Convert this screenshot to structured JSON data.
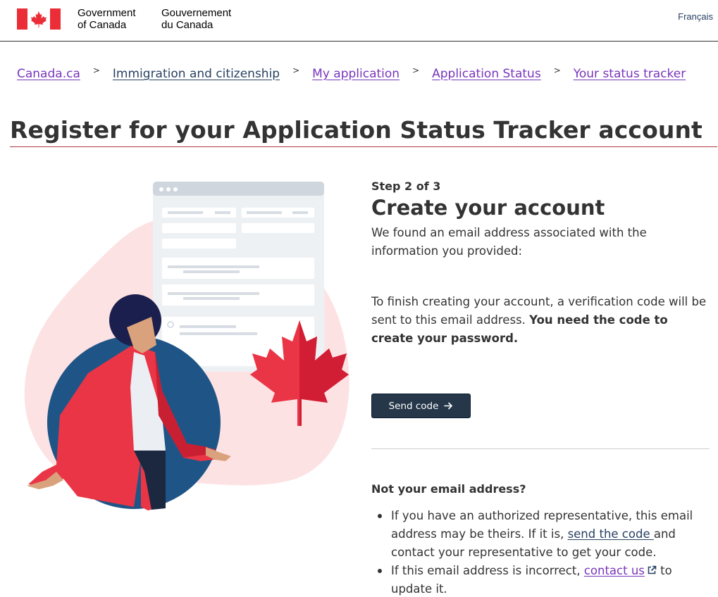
{
  "header": {
    "gov_en_line1": "Government",
    "gov_en_line2": "of Canada",
    "gov_fr_line1": "Gouvernement",
    "gov_fr_line2": "du Canada",
    "language_toggle": "Français"
  },
  "breadcrumb": [
    {
      "label": "Canada.ca"
    },
    {
      "label": "Immigration and citizenship"
    },
    {
      "label": "My application"
    },
    {
      "label": "Application Status"
    },
    {
      "label": "Your status tracker"
    }
  ],
  "breadcrumb_separator": ">",
  "page_title": "Register for your Application Status Tracker account",
  "step": {
    "indicator": "Step 2 of 3",
    "heading": "Create your account",
    "found_text": "We found an email address associated with the information you provided:",
    "finish_text": "To finish creating your account, a verification code will be sent to this email address. ",
    "finish_bold": "You need the code to create your password.",
    "send_button_label": "Send code",
    "send_button_icon": "arrow-right-icon"
  },
  "not_your_email": {
    "heading": "Not your email address?",
    "item1_before": "If you have an authorized representative, this email address may be theirs. If it is, ",
    "item1_link": "send the code ",
    "item1_after": "and contact your representative to get your code.",
    "item2_before": "If this email address is incorrect, ",
    "item2_link": "contact us",
    "item2_link_icon": "external-link-icon",
    "item2_after": " to update it."
  },
  "colors": {
    "flag_red": "#eb2d37",
    "link_visited": "#7834bc",
    "link": "#284162",
    "button_bg": "#26374a",
    "title_rule": "#af3c43"
  }
}
